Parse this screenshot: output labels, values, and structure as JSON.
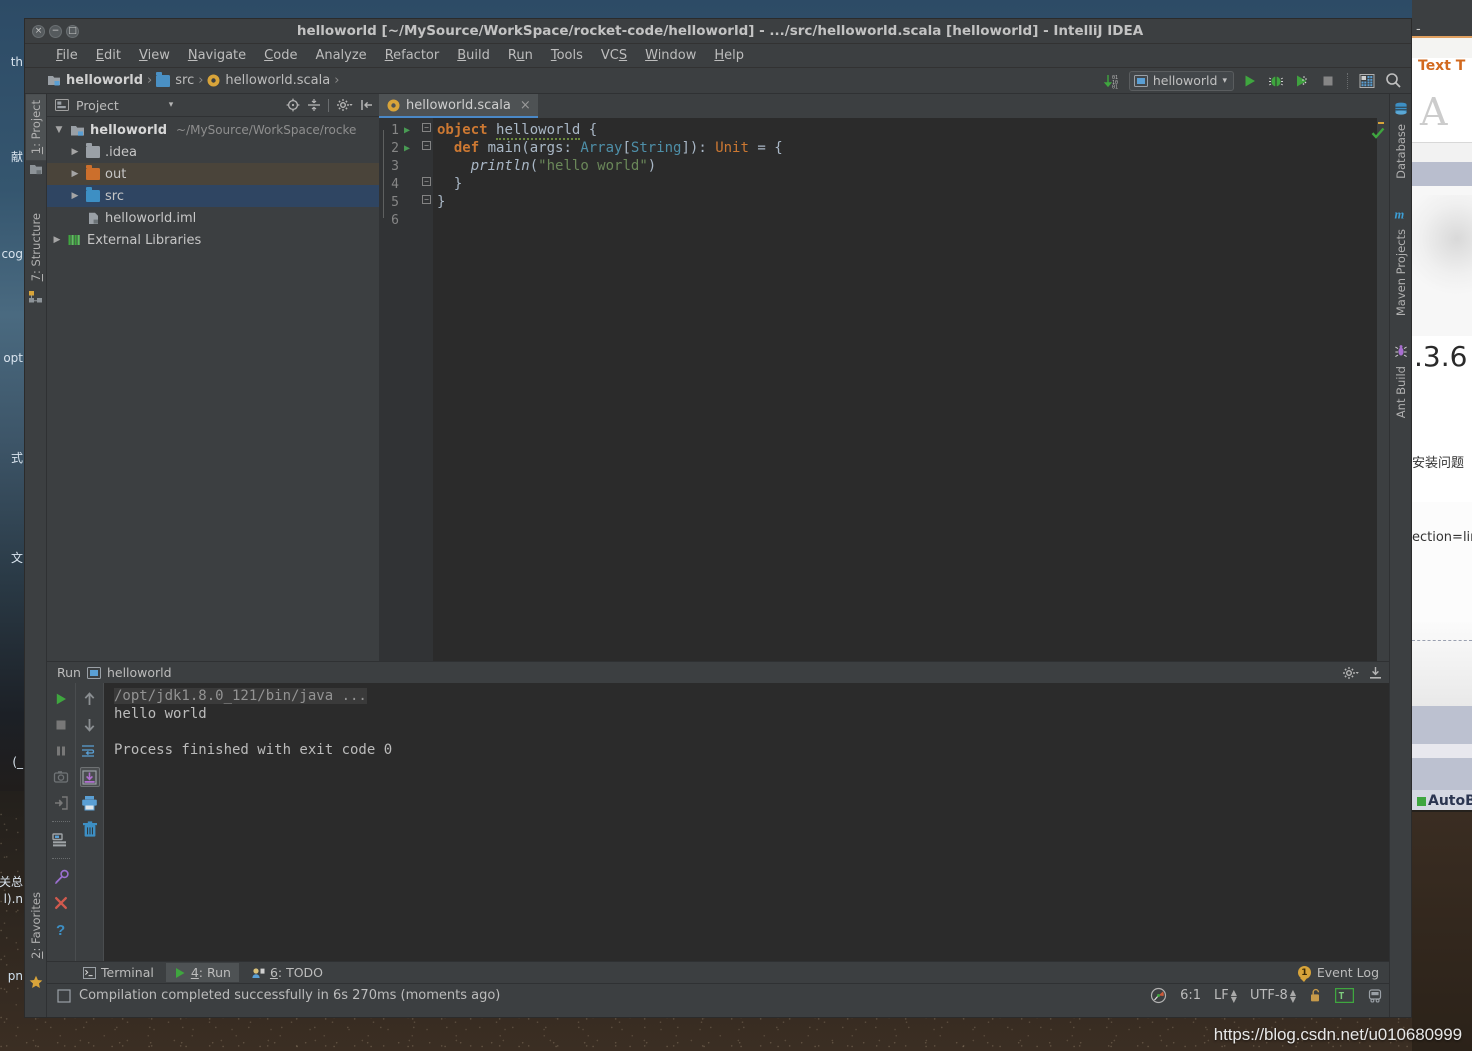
{
  "window": {
    "title": "helloworld [~/MySource/WorkSpace/rocket-code/helloworld] - .../src/helloworld.scala [helloworld] - IntelliJ IDEA",
    "close": "×",
    "minimize": "−",
    "maximize": "□"
  },
  "menu": [
    {
      "label": "File",
      "mnemonic": "F"
    },
    {
      "label": "Edit",
      "mnemonic": "E"
    },
    {
      "label": "View",
      "mnemonic": "V"
    },
    {
      "label": "Navigate",
      "mnemonic": "N"
    },
    {
      "label": "Code",
      "mnemonic": "C"
    },
    {
      "label": "Analyze",
      "mnemonic": ""
    },
    {
      "label": "Refactor",
      "mnemonic": "R"
    },
    {
      "label": "Build",
      "mnemonic": "B"
    },
    {
      "label": "Run",
      "mnemonic": "u"
    },
    {
      "label": "Tools",
      "mnemonic": "T"
    },
    {
      "label": "VCS",
      "mnemonic": "S"
    },
    {
      "label": "Window",
      "mnemonic": "W"
    },
    {
      "label": "Help",
      "mnemonic": "H"
    }
  ],
  "navbar": {
    "crumbs": [
      {
        "label": "helloworld",
        "icon": "module-icon"
      },
      {
        "label": "src",
        "icon": "folder-icon"
      },
      {
        "label": "helloworld.scala",
        "icon": "scala-object-icon"
      }
    ],
    "separator": "›",
    "run_configuration": "helloworld",
    "dropdown_caret": "▾",
    "buttons": [
      "run-button",
      "debug-button",
      "run-coverage-button",
      "stop-button",
      "update-app-button",
      "search-everywhere-button"
    ]
  },
  "left_rail": [
    {
      "label": "1: Project",
      "mnemonic": "1",
      "active": true,
      "icon": "project-icon"
    },
    {
      "label": "7: Structure",
      "mnemonic": "7",
      "active": false,
      "icon": "structure-icon"
    },
    {
      "label": "2: Favorites",
      "mnemonic": "2",
      "active": false,
      "icon": "star-icon"
    }
  ],
  "right_rail": [
    {
      "label": "Database",
      "icon": "database-icon"
    },
    {
      "label": "Maven Projects",
      "icon": "maven-icon"
    },
    {
      "label": "Ant Build",
      "icon": "ant-icon"
    }
  ],
  "project_panel": {
    "title": "Project",
    "dropdown_caret": "▾",
    "toolbar": [
      "locate-icon",
      "collapse-all-icon",
      "settings-gear-icon",
      "hide-icon"
    ],
    "tree": [
      {
        "depth": 0,
        "arrow": "▼",
        "label": "helloworld",
        "path": "~/MySource/WorkSpace/rocke",
        "icon": "module-icon",
        "bold": true,
        "state": "none"
      },
      {
        "depth": 1,
        "arrow": "▶",
        "label": ".idea",
        "path": "",
        "icon": "folder-grey",
        "bold": false,
        "state": "none"
      },
      {
        "depth": 1,
        "arrow": "▶",
        "label": "out",
        "path": "",
        "icon": "folder-orange",
        "bold": false,
        "state": "highlight"
      },
      {
        "depth": 1,
        "arrow": "▶",
        "label": "src",
        "path": "",
        "icon": "folder-blue",
        "bold": false,
        "state": "selected"
      },
      {
        "depth": 2,
        "arrow": "",
        "label": "helloworld.iml",
        "path": "",
        "icon": "iml-icon",
        "bold": false,
        "state": "none"
      },
      {
        "depth": 0,
        "arrow": "▶",
        "label": "External Libraries",
        "path": "",
        "icon": "libraries-icon",
        "bold": false,
        "state": "none"
      }
    ]
  },
  "editor": {
    "tab": {
      "label": "helloworld.scala",
      "icon": "scala-object-icon",
      "close": "×"
    },
    "inspection_status": "ok",
    "line_numbers": [
      "1",
      "2",
      "3",
      "4",
      "5",
      "6"
    ],
    "run_gutter_lines": [
      1,
      2
    ],
    "code_lines": [
      {
        "n": 1,
        "tokens": [
          {
            "t": "object",
            "c": "kw"
          },
          {
            "t": " ",
            "c": ""
          },
          {
            "t": "helloworld",
            "c": "warn"
          },
          {
            "t": " {",
            "c": ""
          }
        ]
      },
      {
        "n": 2,
        "tokens": [
          {
            "t": "  ",
            "c": ""
          },
          {
            "t": "def",
            "c": "kw"
          },
          {
            "t": " main(args: ",
            "c": ""
          },
          {
            "t": "Array",
            "c": "type"
          },
          {
            "t": "[",
            "c": ""
          },
          {
            "t": "String",
            "c": "type"
          },
          {
            "t": "]): ",
            "c": ""
          },
          {
            "t": "Unit",
            "c": "kw2"
          },
          {
            "t": " = {",
            "c": ""
          }
        ]
      },
      {
        "n": 3,
        "tokens": [
          {
            "t": "    ",
            "c": ""
          },
          {
            "t": "println",
            "c": "fn"
          },
          {
            "t": "(",
            "c": ""
          },
          {
            "t": "\"hello world\"",
            "c": "str"
          },
          {
            "t": ")",
            "c": ""
          }
        ]
      },
      {
        "n": 4,
        "tokens": [
          {
            "t": "  }",
            "c": ""
          }
        ]
      },
      {
        "n": 5,
        "tokens": [
          {
            "t": "}",
            "c": ""
          }
        ]
      },
      {
        "n": 6,
        "tokens": [
          {
            "t": "",
            "c": ""
          }
        ]
      }
    ]
  },
  "run_window": {
    "title": "Run",
    "config_name": "helloworld",
    "icon": "run-config-icon",
    "header_buttons": [
      "settings-gear-icon",
      "hide-icon"
    ],
    "left_toolbar": [
      "rerun-icon",
      "stop-icon",
      "pause-icon",
      "dump-threads-icon",
      "exit-icon",
      "console-icon",
      "pin-icon",
      "close-icon",
      "help-icon"
    ],
    "second_toolbar": [
      "up-arrow-icon",
      "down-arrow-icon",
      "soft-wrap-icon",
      "scroll-to-end-icon",
      "print-icon",
      "clear-all-icon"
    ],
    "console": [
      {
        "text": "/opt/jdk1.8.0_121/bin/java ...",
        "style": "cmd"
      },
      {
        "text": "hello world",
        "style": "normal"
      },
      {
        "text": "",
        "style": "normal"
      },
      {
        "text": "Process finished with exit code 0",
        "style": "normal"
      }
    ]
  },
  "bottom_tabs": [
    {
      "label": "Terminal",
      "mnemonic": "",
      "icon": "terminal-icon",
      "active": false
    },
    {
      "label": "4: Run",
      "mnemonic": "4",
      "icon": "run-green-icon",
      "active": true
    },
    {
      "label": "6: TODO",
      "mnemonic": "6",
      "icon": "todo-icon",
      "active": false
    }
  ],
  "event_log": {
    "label": "Event Log",
    "badge": "1"
  },
  "status_bar": {
    "message": "Compilation completed successfully in 6s 270ms (moments ago)",
    "caret_position": "6:1",
    "line_separator": "LF",
    "encoding": "UTF-8",
    "lock_state": "unlocked",
    "indicators": [
      "memory-indicator-icon",
      "lock-icon",
      "text-mode-icon",
      "train-icon"
    ]
  },
  "desktop": {
    "left_fragments": [
      "th",
      "献",
      "cog",
      "opt",
      "式",
      "文",
      "(_",
      "关总",
      "l).n",
      "pn"
    ],
    "right_fragments": [
      {
        "text": "- Present",
        "kind": "titlebar"
      },
      {
        "text": "Text T",
        "kind": "heading"
      },
      {
        "text": "A",
        "kind": "bigletter"
      },
      {
        "text": ".3.6",
        "kind": "version"
      },
      {
        "text": "安装问题",
        "kind": "text"
      },
      {
        "text": "ection=linu",
        "kind": "text"
      },
      {
        "text": "AutoBa",
        "kind": "item"
      }
    ],
    "watermark": "https://blog.csdn.net/u010680999"
  }
}
